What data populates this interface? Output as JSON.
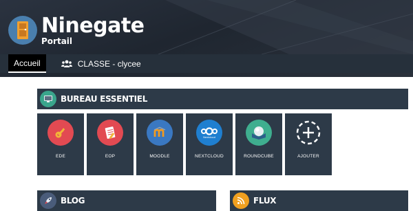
{
  "brand": {
    "title": "Ninegate",
    "subtitle": "Portail"
  },
  "nav": {
    "tabs": [
      {
        "label": "Accueil",
        "active": true
      },
      {
        "label": "CLASSE - clycee",
        "icon": "users-icon"
      }
    ]
  },
  "bureau": {
    "title": "BUREAU ESSENTIEL",
    "icon": "monitor-icon",
    "tiles": [
      {
        "label": "EDE",
        "icon": "key-icon",
        "color": "#e24a52"
      },
      {
        "label": "EOP",
        "icon": "notepad-icon",
        "color": "#e24a52"
      },
      {
        "label": "MOODLE",
        "icon": "moodle-icon",
        "color": "#3a78c2"
      },
      {
        "label": "NEXTCLOUD",
        "icon": "nextcloud-icon",
        "color": "#1f7fd0",
        "icon_text": "Nextcloud"
      },
      {
        "label": "ROUNDCUBE",
        "icon": "roundcube-icon",
        "color": "#3fae8f"
      },
      {
        "label": "AJOUTER",
        "icon": "add-icon",
        "color": "#2d3a48"
      }
    ]
  },
  "blog": {
    "title": "BLOG",
    "icon": "rocket-icon",
    "color": "#4a5c7a"
  },
  "flux": {
    "title": "FLUX",
    "icon": "rss-icon",
    "color": "#f0a020"
  }
}
